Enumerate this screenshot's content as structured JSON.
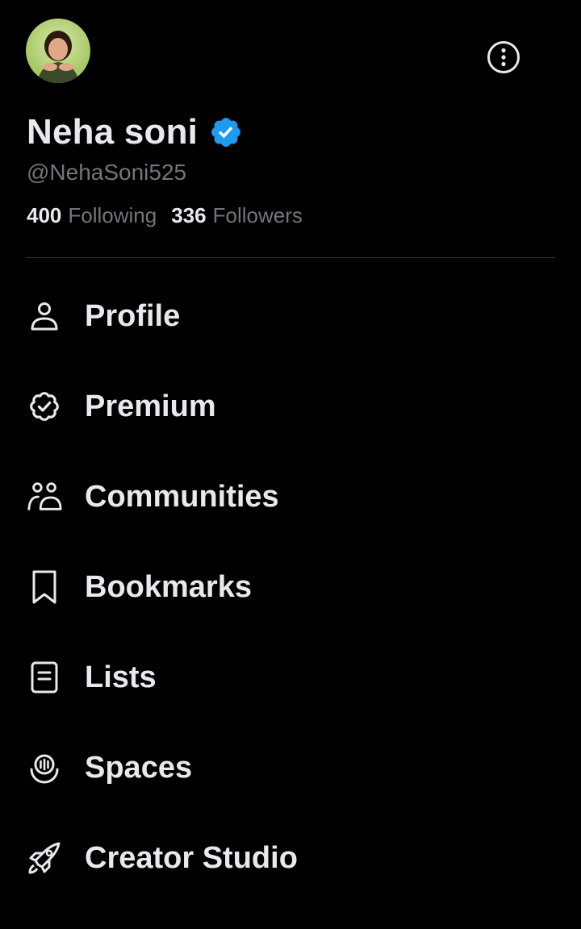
{
  "profile": {
    "name": "Neha soni",
    "handle": "@NehaSoni525",
    "verified": true,
    "verified_color": "#1d9bf0"
  },
  "stats": {
    "following_count": "400",
    "following_label": "Following",
    "followers_count": "336",
    "followers_label": "Followers"
  },
  "header": {
    "more_icon": "more-options-icon"
  },
  "menu": {
    "items": [
      {
        "label": "Profile",
        "icon": "person-icon"
      },
      {
        "label": "Premium",
        "icon": "premium-badge-icon"
      },
      {
        "label": "Communities",
        "icon": "communities-icon"
      },
      {
        "label": "Bookmarks",
        "icon": "bookmark-icon"
      },
      {
        "label": "Lists",
        "icon": "list-icon"
      },
      {
        "label": "Spaces",
        "icon": "spaces-icon"
      },
      {
        "label": "Creator Studio",
        "icon": "rocket-icon"
      }
    ]
  },
  "theme": {
    "background": "#000000",
    "text_primary": "#e7e9ea",
    "text_secondary": "#71767b",
    "divider": "#2f3336"
  }
}
